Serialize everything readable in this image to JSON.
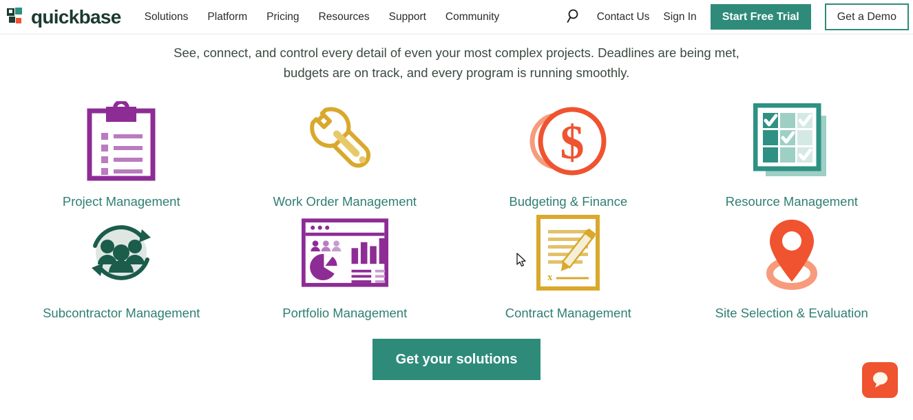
{
  "header": {
    "logo_text": "quickbase",
    "logo_icon": "quickbase-squares-logo",
    "nav": [
      {
        "label": "Solutions"
      },
      {
        "label": "Platform"
      },
      {
        "label": "Pricing"
      },
      {
        "label": "Resources"
      },
      {
        "label": "Support"
      },
      {
        "label": "Community"
      }
    ],
    "search_icon": "search-icon",
    "contact_label": "Contact Us",
    "signin_label": "Sign In",
    "trial_label": "Start Free Trial",
    "demo_label": "Get a Demo"
  },
  "intro": {
    "paragraph": "See, connect, and control every detail of even your most complex projects. Deadlines are being met, budgets are on track, and every program is running smoothly."
  },
  "solutions": [
    {
      "label": "Project Management",
      "icon": "clipboard-checklist-icon"
    },
    {
      "label": "Work Order Management",
      "icon": "wrench-icon"
    },
    {
      "label": "Budgeting & Finance",
      "icon": "dollar-coin-icon"
    },
    {
      "label": "Resource Management",
      "icon": "checklist-grid-icon"
    },
    {
      "label": "Subcontractor Management",
      "icon": "people-cycle-icon"
    },
    {
      "label": "Portfolio Management",
      "icon": "dashboard-charts-icon"
    },
    {
      "label": "Contract Management",
      "icon": "signed-document-icon"
    },
    {
      "label": "Site Selection & Evaluation",
      "icon": "map-pin-icon"
    }
  ],
  "cta": {
    "label": "Get your solutions"
  },
  "chat": {
    "icon": "chat-bubble-icon"
  },
  "colors": {
    "brand_green": "#2e8b7a",
    "link_teal": "#2f7f72",
    "logo_dark": "#1b3b2e",
    "purple": "#8e2c96",
    "gold": "#d9a82c",
    "orange": "#ef5330",
    "teal": "#2e9183",
    "dark_green": "#1b5c4b"
  }
}
